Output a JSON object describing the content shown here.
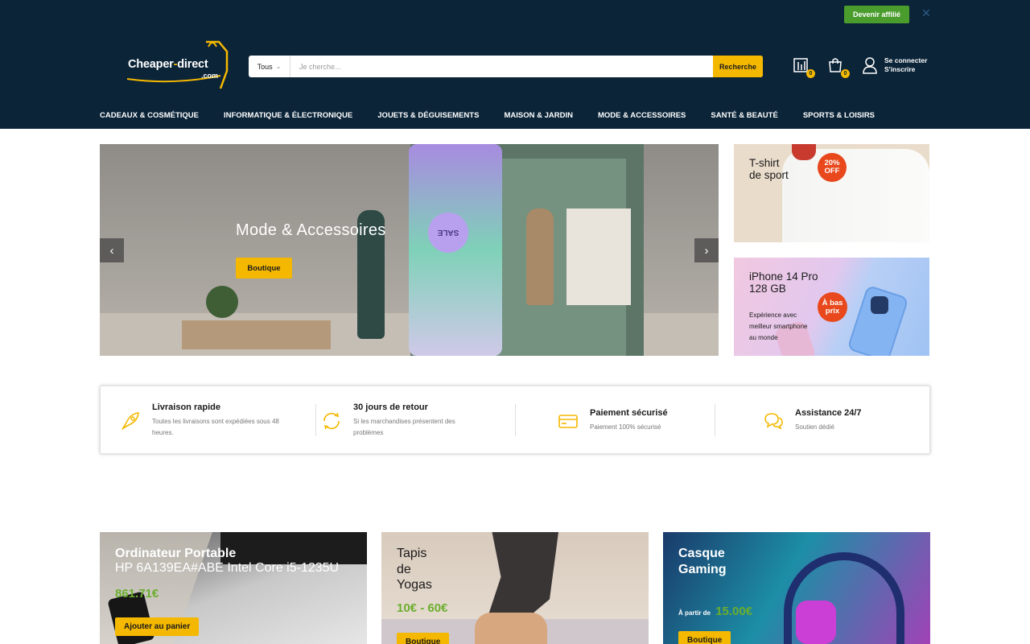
{
  "header": {
    "affiliate_label": "Devenir affilié",
    "close_glyph": "✕",
    "logo": {
      "name": "Cheaper",
      "dash": "-",
      "name2": "direct",
      "domain": ".com"
    },
    "search": {
      "category": "Tous",
      "placeholder": "Je cherche...",
      "button_label": "Recherche"
    },
    "compare_count": "0",
    "cart_count": "0",
    "account": {
      "line1": "Se connecter",
      "line2": "S'inscrire"
    },
    "colors": {
      "background": "#0b2438",
      "accent": "#f5b800",
      "affiliate": "#4a9c2d"
    }
  },
  "nav": {
    "items": [
      "CADEAUX & COSMÉTIQUE",
      "INFORMATIQUE & ÉLECTRONIQUE",
      "JOUETS & DÉGUISEMENTS",
      "MAISON & JARDIN",
      "MODE & ACCESSOIRES",
      "SANTÉ & BEAUTÉ",
      "SPORTS & LOISIRS"
    ]
  },
  "hero": {
    "title": "Mode & Accessoires",
    "button_label": "Boutique",
    "prev_glyph": "‹",
    "next_glyph": "›",
    "sale_text": "SALE"
  },
  "side_banners": [
    {
      "title": "T-shirt\nde sport",
      "badge": "20%\nOFF"
    },
    {
      "title": "iPhone 14 Pro\n128 GB",
      "badge": "À bas\nprix",
      "description": "Expérience avec\nmeilleur smartphone\nau monde"
    }
  ],
  "features": [
    {
      "icon": "rocket-icon",
      "title": "Livraison rapide",
      "desc": "Toutes les livraisons sont expédiées sous 48\nheures."
    },
    {
      "icon": "refresh-icon",
      "title": "30 jours de retour",
      "desc": "Si les marchandises présentent des\nproblèmes"
    },
    {
      "icon": "credit-card-icon",
      "title": "Paiement sécurisé",
      "desc": "Paiement 100% sécurisé"
    },
    {
      "icon": "chat-bubbles-icon",
      "title": "Assistance 24/7",
      "desc": "Soutien dédié"
    }
  ],
  "cards": [
    {
      "title": "Ordinateur Portable",
      "subtitle": "HP 6A139EA#ABE Intel Core i5-1235U",
      "price": "861.71€",
      "button_label": "Ajouter au panier"
    },
    {
      "title": "Tapis\nde\nYogas",
      "price": "10€ - 60€",
      "button_label": "Boutique"
    },
    {
      "title": "Casque\nGaming",
      "price_prefix": "À partir de",
      "price": "15.00€",
      "button_label": "Boutique"
    }
  ]
}
